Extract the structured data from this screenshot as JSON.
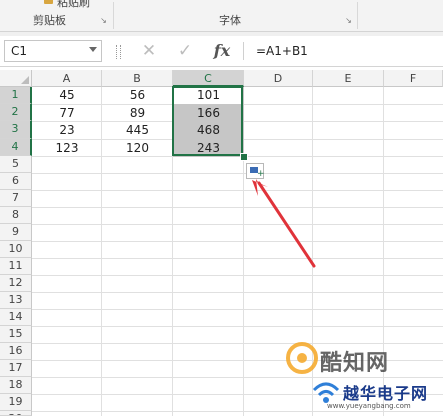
{
  "ribbon": {
    "clipboard_partial": "粘贴刷",
    "clipboard_label": "剪贴板",
    "font_label": "字体"
  },
  "formula_bar": {
    "name_box": "C1",
    "cancel_symbol": "✕",
    "enter_symbol": "✓",
    "fx_label": "fx",
    "formula": "=A1+B1"
  },
  "columns": [
    "A",
    "B",
    "C",
    "D",
    "E",
    "F"
  ],
  "selected_column": "C",
  "rows": [
    "1",
    "2",
    "3",
    "4",
    "5",
    "6",
    "7",
    "8",
    "9",
    "10",
    "11",
    "12",
    "13",
    "14",
    "15",
    "16",
    "17",
    "18",
    "19",
    "20"
  ],
  "selected_rows": [
    "1",
    "2",
    "3",
    "4"
  ],
  "cells": [
    {
      "a": "45",
      "b": "56",
      "c": "101"
    },
    {
      "a": "77",
      "b": "89",
      "c": "166"
    },
    {
      "a": "23",
      "b": "445",
      "c": "468"
    },
    {
      "a": "123",
      "b": "120",
      "c": "243"
    }
  ],
  "selection_range": "C1:C4",
  "quick_analysis_icon": "quick-analysis-icon",
  "annotation": {
    "type": "arrow",
    "color": "#e0333a"
  },
  "watermark": {
    "line1": "酷知网",
    "line2": "越华电子网",
    "line3": "www.yueyangbang.com"
  },
  "colors": {
    "accent": "#217346",
    "selection_fill": "#c6c6c6"
  }
}
